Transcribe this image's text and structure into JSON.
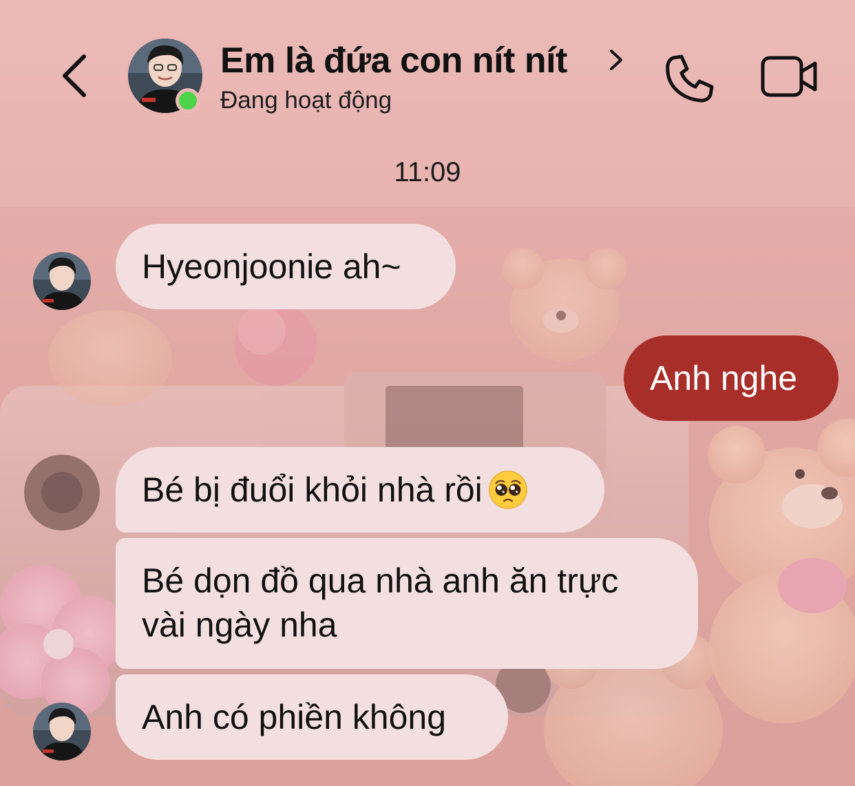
{
  "header": {
    "contact_name": "Em là đứa con nít nít",
    "status": "Đang hoạt động",
    "icons": {
      "back": "chevron-left-icon",
      "name_chevron": "chevron-right-icon",
      "call": "phone-icon",
      "video": "video-camera-icon"
    },
    "online_color": "#4cd44a"
  },
  "timestamp": "11:09",
  "messages": [
    {
      "direction": "incoming",
      "text": "Hyeonjoonie ah~"
    },
    {
      "direction": "outgoing",
      "text": "Anh nghe"
    },
    {
      "direction": "incoming",
      "text": "Bé bị đuổi khỏi nhà rồi",
      "emoji": "pleading-face"
    },
    {
      "direction": "incoming",
      "text_line1": "Bé dọn đồ qua nhà anh ăn trực",
      "text_line2": "vài ngày nha"
    },
    {
      "direction": "incoming",
      "text": "Anh có phiền không"
    }
  ],
  "colors": {
    "incoming_bubble": "#f4dfe0",
    "outgoing_bubble": "#a82e29",
    "background": "#e8b2ae"
  }
}
